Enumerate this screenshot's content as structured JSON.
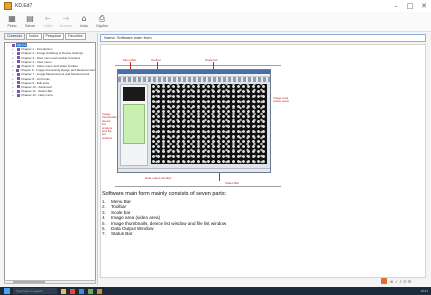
{
  "window": {
    "title": "KD.Ed7",
    "controls": [
      "–",
      "□",
      "✕"
    ]
  },
  "toolbar": {
    "buttons": [
      {
        "icon": "grid-icon",
        "glyph": "▦",
        "label": "Pinho",
        "disabled": false
      },
      {
        "icon": "list-icon",
        "glyph": "▤",
        "label": "Salvar",
        "disabled": false
      },
      {
        "icon": "back-icon",
        "glyph": "←",
        "label": "Voltar",
        "disabled": true
      },
      {
        "icon": "forward-icon",
        "glyph": "→",
        "label": "Avançar",
        "disabled": true
      },
      {
        "icon": "home-icon",
        "glyph": "⌂",
        "label": "Início",
        "disabled": false
      },
      {
        "icon": "print-icon",
        "glyph": "⎙",
        "label": "Opções",
        "disabled": false
      }
    ]
  },
  "tabs": [
    "Conteúdo",
    "Índice",
    "Pesquisar",
    "Favoritos"
  ],
  "tree": [
    {
      "label": "KD-7.0",
      "level": 0,
      "selected": true
    },
    {
      "label": "Chapter 1 - Introduction",
      "level": 1
    },
    {
      "label": "Chapter 2 - Image Grabbing & Device Settings",
      "level": 1
    },
    {
      "label": "Chapter 3 - Files menu and toolbar functions",
      "level": 1
    },
    {
      "label": "Chapter 4 - View menu",
      "level": 1
    },
    {
      "label": "Chapter 5 - Video menu and Video Toolbar",
      "level": 1
    },
    {
      "label": "Chapter 6 - Image Processing Range and Measurement",
      "level": 1
    },
    {
      "label": "Chapter 7 - Image Measurement and Measurement",
      "level": 1
    },
    {
      "label": "Chapter 8 - Grid tools",
      "level": 1
    },
    {
      "label": "Chapter 9 - Edit tools",
      "level": 1
    },
    {
      "label": "Chapter 10 - Advanced",
      "level": 1
    },
    {
      "label": "Chapter 11 - Status Bar",
      "level": 1
    },
    {
      "label": "Chapter 12 - Help menu",
      "level": 1
    }
  ],
  "address": "Name: Software main form",
  "document": {
    "callouts": {
      "menu_bar": "Menu Bar",
      "toolbar": "Toolbar",
      "scale_bar": "Scale bar",
      "thumbnails": "Image thumbnails, device list window and file list window",
      "image_area": "Image area (video area)",
      "status_bar": "Status Bar",
      "data_output": "Data output window"
    },
    "intro": "Software main form mainly consists of seven parts:",
    "items": [
      {
        "n": "1.",
        "text": "Menu Bar"
      },
      {
        "n": "2.",
        "text": "Toolbar"
      },
      {
        "n": "3.",
        "text": "Scale bar"
      },
      {
        "n": "4.",
        "text": "Image area (video area)"
      },
      {
        "n": "5.",
        "text": "Image thumbnails, device list window and file list window"
      },
      {
        "n": "6.",
        "text": "Data Output Window"
      },
      {
        "n": "7.",
        "text": "Status Bar"
      }
    ]
  },
  "status_tray": "⊕ ✓ ♪ ☷ ⚙",
  "taskbar": {
    "search_placeholder": "Type here to search",
    "clock": "10:21"
  }
}
